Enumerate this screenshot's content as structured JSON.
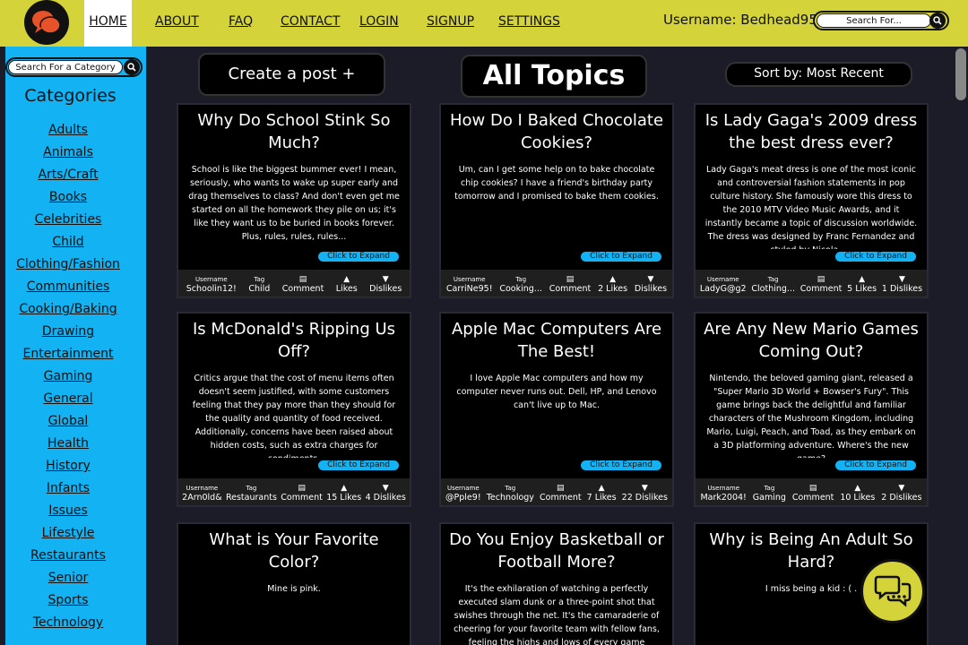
{
  "nav": {
    "items": [
      "HOME",
      "ABOUT",
      "FAQ",
      "CONTACT",
      "LOGIN",
      "SIGNUP",
      "SETTINGS"
    ],
    "username": "Username: Bedhead95!",
    "search_placeholder": "Search For...",
    "logo_icon": "chat-bubbles-icon",
    "brand_color": "#d4d33a"
  },
  "sidebar": {
    "search_placeholder": "Search For a Category",
    "title": "Categories",
    "categories": [
      "Adults",
      "Animals",
      "Arts/Craft",
      "Books",
      "Celebrities",
      "Child",
      "Clothing/Fashion",
      "Communities",
      "Cooking/Baking",
      "Drawing",
      "Entertainment",
      "Gaming",
      "General",
      "Global",
      "Health",
      "History",
      "Infants",
      "Issues",
      "Lifestyle",
      "Restaurants",
      "Senior",
      "Sports",
      "Technology"
    ],
    "accent_color": "#13b2f2"
  },
  "main": {
    "create_label": "Create a post +",
    "page_title": "All Topics",
    "sort_label": "Sort by: Most Recent",
    "expand_label": "Click to Expand",
    "meta_labels": {
      "username": "Username",
      "tag": "Tag",
      "comment": "Comment"
    },
    "posts": [
      {
        "title": "Why Do School Stink So Much?",
        "body": "School is like the biggest bummer ever! I mean, seriously, who wants to wake up super early and drag themselves to class? And don't even get me started on all the homework they pile on us; it's like they want us to be buried in books forever. Plus, rules, rules, rules...",
        "username": "Schoolin12!",
        "tag": "Child",
        "likes": "Likes",
        "dislikes": "Dislikes"
      },
      {
        "title": "How Do I Baked Chocolate Cookies?",
        "body": "Um, can I get some help on to bake chocolate chip cookies? I have a friend's birthday party tomorrow and I promised to bake them cookies.",
        "username": "CarriNe95!",
        "tag": "Cooking...",
        "likes": "2 Likes",
        "dislikes": "Dislikes"
      },
      {
        "title": "Is Lady Gaga's 2009 dress the best dress ever?",
        "body": "Lady Gaga's meat dress is one of the most iconic and controversial fashion statements in pop culture history. She famously wore this dress to the 2010 MTV Video Music Awards, and it instantly became a topic of discussion worldwide. The dress was designed by Franc Fernandez and styled by Nicola ....",
        "username": "LadyG@g2",
        "tag": "Clothing...",
        "likes": "5 Likes",
        "dislikes": "1 Dislikes"
      },
      {
        "title": "Is McDonald's Ripping Us Off?",
        "body": "Critics argue that the cost of menu items often doesn't seem justified, with some customers feeling that they pay more than they should for the quality and quantity of food received. Additionally, concerns have been raised about hidden costs, such as extra charges for condiments.",
        "username": "2Arn0ld&",
        "tag": "Restaurants",
        "likes": "15 Likes",
        "dislikes": "4 Dislikes"
      },
      {
        "title": "Apple Mac Computers Are The Best!",
        "body": "I love Apple Mac computers and how my computer never runs out. Dell, HP, and Lenovo can't live up to Mac.",
        "username": "@Pple9!",
        "tag": "Technology",
        "likes": "7 Likes",
        "dislikes": "22 Dislikes"
      },
      {
        "title": "Are Any New Mario Games Coming Out?",
        "body": "Nintendo, the beloved gaming giant, released a \"Super Mario 3D World + Bowser's Fury\". This game brings back the delightful and familiar characters of the Mushroom Kingdom, including Mario, Luigi, Peach, and Toad, as they embark on a 3D platforming adventure. Where's the new game?",
        "username": "Mark2004!",
        "tag": "Gaming",
        "likes": "10 Likes",
        "dislikes": "2 Dislikes"
      },
      {
        "title": "What is Your Favorite Color?",
        "body": "Mine is pink.",
        "username": "",
        "tag": "",
        "likes": "",
        "dislikes": ""
      },
      {
        "title": "Do You Enjoy Basketball or Football More?",
        "body": "It's the exhilaration of watching a perfectly executed slam dunk or a three-point shot that swishes through the net. It's the camaraderie of cheering for your favorite team with fellow fans, feeling the highs and lows of every game together.",
        "username": "",
        "tag": "",
        "likes": "",
        "dislikes": ""
      },
      {
        "title": "Why is Being An Adult So Hard?",
        "body": "I miss being a kid : ( .",
        "username": "",
        "tag": "",
        "likes": "",
        "dislikes": ""
      }
    ]
  }
}
